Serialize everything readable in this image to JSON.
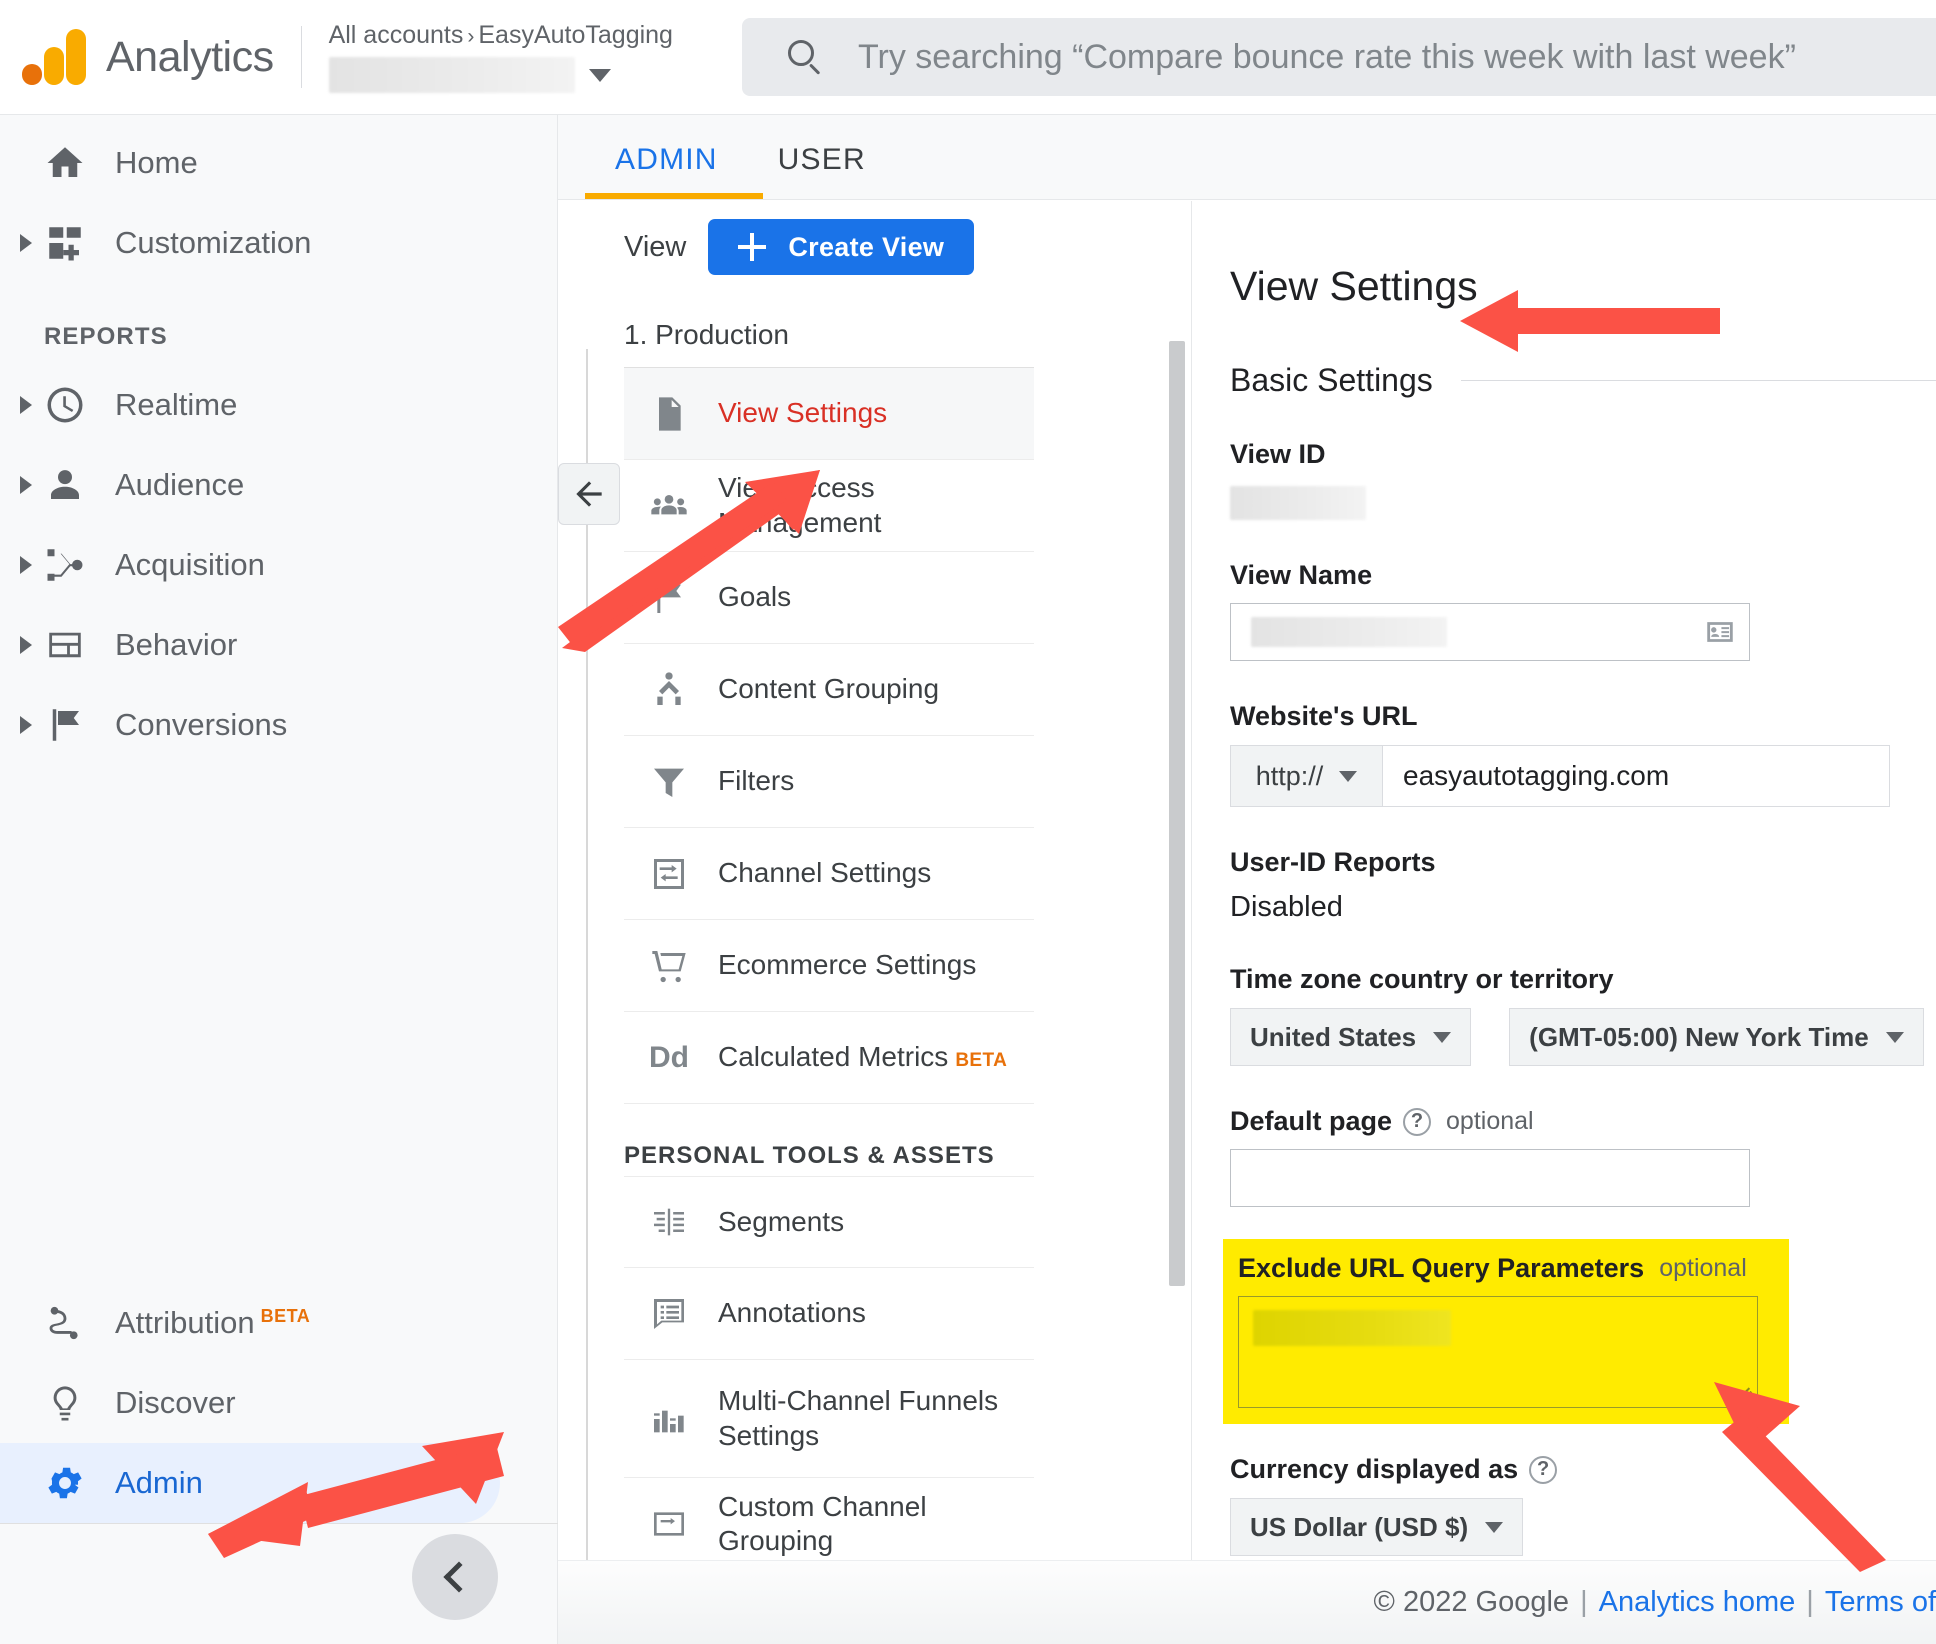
{
  "header": {
    "brand": "Analytics",
    "breadcrumb_all": "All accounts",
    "breadcrumb_sep": "›",
    "breadcrumb_account": "EasyAutoTagging",
    "account_value": "",
    "search_placeholder": "Try searching “Compare bounce rate this week with last week”"
  },
  "sidebar": {
    "top_items": [
      {
        "label": "Home",
        "icon": "home-icon",
        "expandable": false
      },
      {
        "label": "Customization",
        "icon": "customization-icon",
        "expandable": true
      }
    ],
    "reports_title": "REPORTS",
    "report_items": [
      {
        "label": "Realtime",
        "icon": "clock-icon",
        "expandable": true
      },
      {
        "label": "Audience",
        "icon": "person-icon",
        "expandable": true
      },
      {
        "label": "Acquisition",
        "icon": "acquisition-icon",
        "expandable": true
      },
      {
        "label": "Behavior",
        "icon": "behavior-icon",
        "expandable": true
      },
      {
        "label": "Conversions",
        "icon": "flag-icon",
        "expandable": true
      }
    ],
    "bottom_items": [
      {
        "label": "Attribution",
        "badge": "BETA",
        "icon": "attribution-icon",
        "active": false
      },
      {
        "label": "Discover",
        "badge": "",
        "icon": "bulb-icon",
        "active": false
      },
      {
        "label": "Admin",
        "badge": "",
        "icon": "gear-icon",
        "active": true
      }
    ]
  },
  "tabs": [
    {
      "label": "ADMIN",
      "active": true
    },
    {
      "label": "USER",
      "active": false
    }
  ],
  "view_panel": {
    "view_label": "View",
    "create_button": "Create View",
    "view_name": "1. Production",
    "items": [
      {
        "label": "View Settings",
        "icon": "document-icon",
        "selected": true
      },
      {
        "label": "View Access Management",
        "icon": "people-icon",
        "selected": false
      },
      {
        "label": "Goals",
        "icon": "flag-icon",
        "selected": false
      },
      {
        "label": "Content Grouping",
        "icon": "content-grouping-icon",
        "selected": false
      },
      {
        "label": "Filters",
        "icon": "funnel-icon",
        "selected": false
      },
      {
        "label": "Channel Settings",
        "icon": "channel-icon",
        "selected": false
      },
      {
        "label": "Ecommerce Settings",
        "icon": "cart-icon",
        "selected": false
      },
      {
        "label": "Calculated Metrics",
        "badge": "BETA",
        "icon": "dd-icon",
        "selected": false
      }
    ],
    "group_title": "PERSONAL TOOLS & ASSETS",
    "group_items": [
      {
        "label": "Segments",
        "icon": "segments-icon"
      },
      {
        "label": "Annotations",
        "icon": "annotations-icon"
      },
      {
        "label": "Multi-Channel Funnels Settings",
        "icon": "funnels-icon"
      },
      {
        "label": "Custom Channel Grouping",
        "icon": "custom-channel-icon"
      }
    ]
  },
  "settings": {
    "title": "View Settings",
    "basic_settings": "Basic Settings",
    "view_id_label": "View ID",
    "view_id_value": "",
    "view_name_label": "View Name",
    "view_name_value": "",
    "website_url_label": "Website's URL",
    "protocol": "http://",
    "website_url_value": "easyautotagging.com",
    "user_id_label": "User-ID Reports",
    "user_id_value": "Disabled",
    "timezone_label": "Time zone country or territory",
    "timezone_country": "United States",
    "timezone_zone": "(GMT-05:00) New York Time",
    "default_page_label": "Default page",
    "default_page_optional": "optional",
    "default_page_value": "",
    "exclude_label": "Exclude URL Query Parameters",
    "exclude_optional": "optional",
    "exclude_value": "",
    "currency_label": "Currency displayed as",
    "currency_value": "US Dollar (USD $)"
  },
  "footer": {
    "copyright": "© 2022 Google",
    "link_home": "Analytics home",
    "link_terms": "Terms of",
    "pipe": "|"
  },
  "colors": {
    "accent_blue": "#1a73e8",
    "accent_orange": "#f9ab00",
    "selected_red": "#d93025",
    "highlight_yellow": "#ffeb00",
    "arrow_red": "#fb5246"
  }
}
